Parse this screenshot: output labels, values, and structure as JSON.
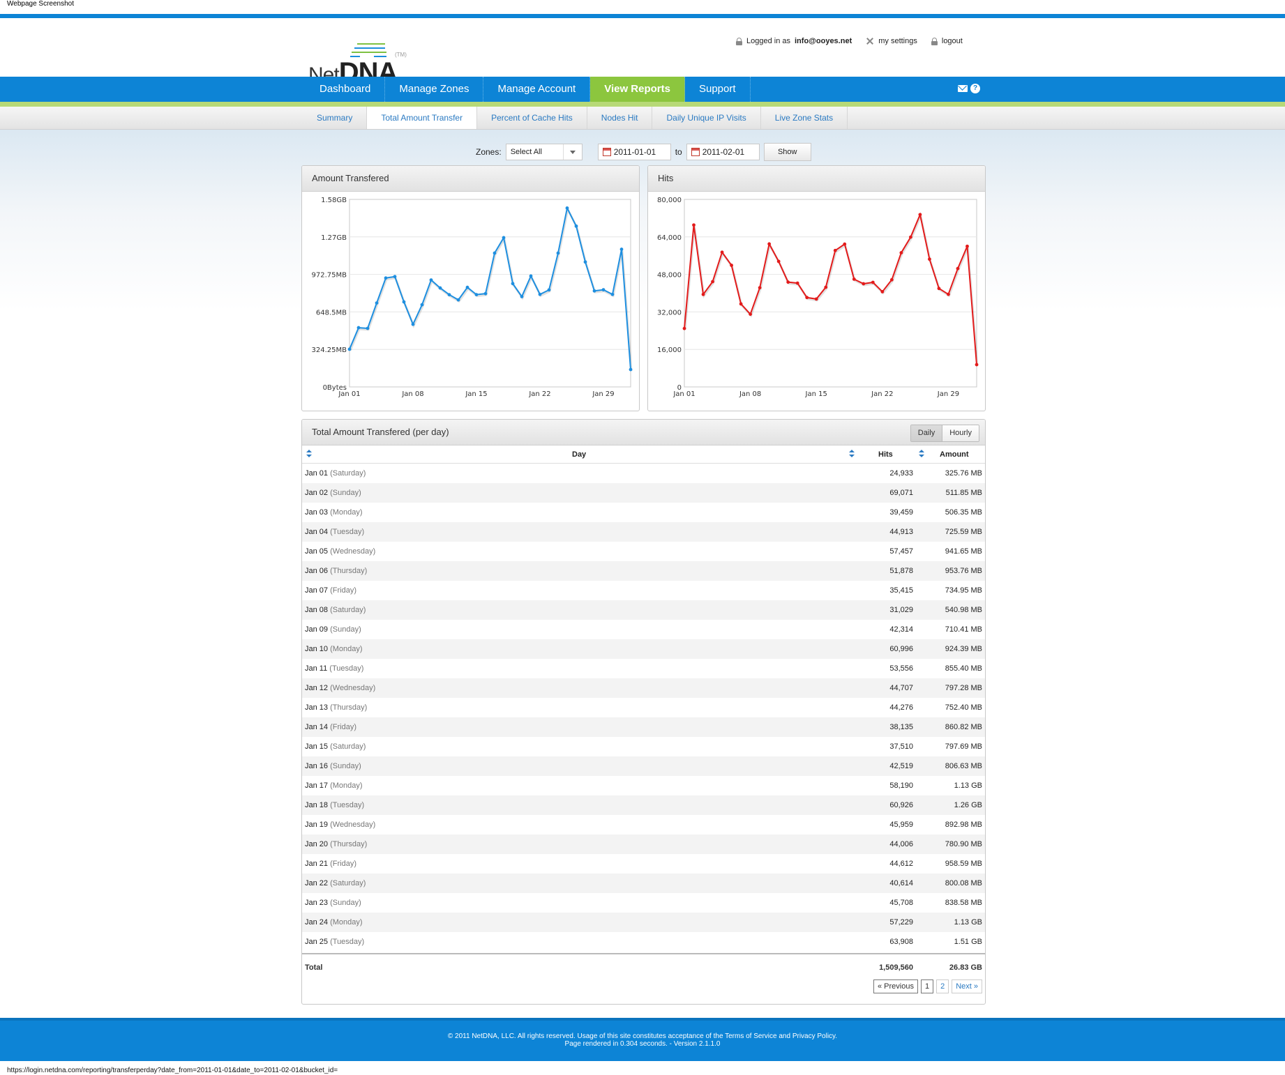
{
  "capture_title": "Webpage Screenshot",
  "logo": {
    "net": "Net",
    "dna": "DNA",
    "tm": "(TM)"
  },
  "user_bar": {
    "logged_prefix": "Logged in as",
    "email": "info@ooyes.net",
    "settings": "my settings",
    "logout": "logout"
  },
  "main_nav": [
    {
      "label": "Dashboard",
      "active": false
    },
    {
      "label": "Manage Zones",
      "active": false
    },
    {
      "label": "Manage Account",
      "active": false
    },
    {
      "label": "View Reports",
      "active": true
    },
    {
      "label": "Support",
      "active": false
    }
  ],
  "sub_nav": [
    {
      "label": "Summary",
      "active": false
    },
    {
      "label": "Total Amount Transfer",
      "active": true
    },
    {
      "label": "Percent of Cache Hits",
      "active": false
    },
    {
      "label": "Nodes Hit",
      "active": false
    },
    {
      "label": "Daily Unique IP Visits",
      "active": false
    },
    {
      "label": "Live Zone Stats",
      "active": false
    }
  ],
  "filter": {
    "zones_label": "Zones:",
    "zones_value": "Select All",
    "date_from": "2011-01-01",
    "to_label": "to",
    "date_to": "2011-02-01",
    "show_label": "Show"
  },
  "chart_data": [
    {
      "type": "line",
      "title": "Amount Transfered",
      "color": "#1e8fe0",
      "x": [
        "Jan 01",
        "Jan 02",
        "Jan 03",
        "Jan 04",
        "Jan 05",
        "Jan 06",
        "Jan 07",
        "Jan 08",
        "Jan 09",
        "Jan 10",
        "Jan 11",
        "Jan 12",
        "Jan 13",
        "Jan 14",
        "Jan 15",
        "Jan 16",
        "Jan 17",
        "Jan 18",
        "Jan 19",
        "Jan 20",
        "Jan 21",
        "Jan 22",
        "Jan 23",
        "Jan 24",
        "Jan 25",
        "Jan 26",
        "Jan 27",
        "Jan 28",
        "Jan 29",
        "Jan 30",
        "Jan 31"
      ],
      "values": [
        325.76,
        511.85,
        506.35,
        725.59,
        941.65,
        953.76,
        734.95,
        540.98,
        710.41,
        924.39,
        855.4,
        797.28,
        752.4,
        860.82,
        797.69,
        806.63,
        1157,
        1290,
        892.98,
        780.9,
        958.59,
        800.08,
        838.58,
        1157,
        1546,
        1390,
        1080,
        830,
        840,
        800,
        1190,
        150
      ],
      "y_ticks": [
        "0Bytes",
        "324.25MB",
        "648.5MB",
        "972.75MB",
        "1.27GB",
        "1.58GB"
      ],
      "x_ticks": [
        "Jan 01",
        "Jan 08",
        "Jan 15",
        "Jan 22",
        "Jan 29"
      ],
      "ylim": [
        0,
        1621.25
      ]
    },
    {
      "type": "line",
      "title": "Hits",
      "color": "#e31b1b",
      "x": [
        "Jan 01",
        "Jan 02",
        "Jan 03",
        "Jan 04",
        "Jan 05",
        "Jan 06",
        "Jan 07",
        "Jan 08",
        "Jan 09",
        "Jan 10",
        "Jan 11",
        "Jan 12",
        "Jan 13",
        "Jan 14",
        "Jan 15",
        "Jan 16",
        "Jan 17",
        "Jan 18",
        "Jan 19",
        "Jan 20",
        "Jan 21",
        "Jan 22",
        "Jan 23",
        "Jan 24",
        "Jan 25",
        "Jan 26",
        "Jan 27",
        "Jan 28",
        "Jan 29",
        "Jan 30",
        "Jan 31"
      ],
      "values": [
        24933,
        69071,
        39459,
        44913,
        57457,
        51878,
        35415,
        31029,
        42314,
        60996,
        53556,
        44707,
        44276,
        38135,
        37510,
        42519,
        58190,
        60926,
        45959,
        44006,
        44612,
        40614,
        45708,
        57229,
        63908,
        73500,
        54500,
        42000,
        39500,
        50500,
        60000,
        9500
      ],
      "y_ticks": [
        "0",
        "16,000",
        "32,000",
        "48,000",
        "64,000",
        "80,000"
      ],
      "x_ticks": [
        "Jan 01",
        "Jan 08",
        "Jan 15",
        "Jan 22",
        "Jan 29"
      ],
      "ylim": [
        0,
        80000
      ]
    }
  ],
  "table": {
    "title": "Total Amount Transfered (per day)",
    "toggle": [
      "Daily",
      "Hourly"
    ],
    "headers": {
      "day": "Day",
      "hits": "Hits",
      "amount": "Amount"
    },
    "rows": [
      {
        "day": "Jan 01",
        "dow": "(Saturday)",
        "hits": "24,933",
        "amount": "325.76 MB"
      },
      {
        "day": "Jan 02",
        "dow": "(Sunday)",
        "hits": "69,071",
        "amount": "511.85 MB"
      },
      {
        "day": "Jan 03",
        "dow": "(Monday)",
        "hits": "39,459",
        "amount": "506.35 MB"
      },
      {
        "day": "Jan 04",
        "dow": "(Tuesday)",
        "hits": "44,913",
        "amount": "725.59 MB"
      },
      {
        "day": "Jan 05",
        "dow": "(Wednesday)",
        "hits": "57,457",
        "amount": "941.65 MB"
      },
      {
        "day": "Jan 06",
        "dow": "(Thursday)",
        "hits": "51,878",
        "amount": "953.76 MB"
      },
      {
        "day": "Jan 07",
        "dow": "(Friday)",
        "hits": "35,415",
        "amount": "734.95 MB"
      },
      {
        "day": "Jan 08",
        "dow": "(Saturday)",
        "hits": "31,029",
        "amount": "540.98 MB"
      },
      {
        "day": "Jan 09",
        "dow": "(Sunday)",
        "hits": "42,314",
        "amount": "710.41 MB"
      },
      {
        "day": "Jan 10",
        "dow": "(Monday)",
        "hits": "60,996",
        "amount": "924.39 MB"
      },
      {
        "day": "Jan 11",
        "dow": "(Tuesday)",
        "hits": "53,556",
        "amount": "855.40 MB"
      },
      {
        "day": "Jan 12",
        "dow": "(Wednesday)",
        "hits": "44,707",
        "amount": "797.28 MB"
      },
      {
        "day": "Jan 13",
        "dow": "(Thursday)",
        "hits": "44,276",
        "amount": "752.40 MB"
      },
      {
        "day": "Jan 14",
        "dow": "(Friday)",
        "hits": "38,135",
        "amount": "860.82 MB"
      },
      {
        "day": "Jan 15",
        "dow": "(Saturday)",
        "hits": "37,510",
        "amount": "797.69 MB"
      },
      {
        "day": "Jan 16",
        "dow": "(Sunday)",
        "hits": "42,519",
        "amount": "806.63 MB"
      },
      {
        "day": "Jan 17",
        "dow": "(Monday)",
        "hits": "58,190",
        "amount": "1.13 GB"
      },
      {
        "day": "Jan 18",
        "dow": "(Tuesday)",
        "hits": "60,926",
        "amount": "1.26 GB"
      },
      {
        "day": "Jan 19",
        "dow": "(Wednesday)",
        "hits": "45,959",
        "amount": "892.98 MB"
      },
      {
        "day": "Jan 20",
        "dow": "(Thursday)",
        "hits": "44,006",
        "amount": "780.90 MB"
      },
      {
        "day": "Jan 21",
        "dow": "(Friday)",
        "hits": "44,612",
        "amount": "958.59 MB"
      },
      {
        "day": "Jan 22",
        "dow": "(Saturday)",
        "hits": "40,614",
        "amount": "800.08 MB"
      },
      {
        "day": "Jan 23",
        "dow": "(Sunday)",
        "hits": "45,708",
        "amount": "838.58 MB"
      },
      {
        "day": "Jan 24",
        "dow": "(Monday)",
        "hits": "57,229",
        "amount": "1.13 GB"
      },
      {
        "day": "Jan 25",
        "dow": "(Tuesday)",
        "hits": "63,908",
        "amount": "1.51 GB"
      }
    ],
    "total": {
      "label": "Total",
      "hits": "1,509,560",
      "amount": "26.83 GB"
    },
    "pager": {
      "prev": "« Previous",
      "pages": [
        "1",
        "2"
      ],
      "next": "Next »"
    }
  },
  "footer": {
    "line1": "© 2011 NetDNA, LLC. All rights reserved. Usage of this site constitutes acceptance of the Terms of Service and Privacy Policy.",
    "line2": "Page rendered in 0.304 seconds. - Version 2.1.1.0"
  },
  "status_url": "https://login.netdna.com/reporting/transferperday?date_from=2011-01-01&date_to=2011-02-01&bucket_id="
}
